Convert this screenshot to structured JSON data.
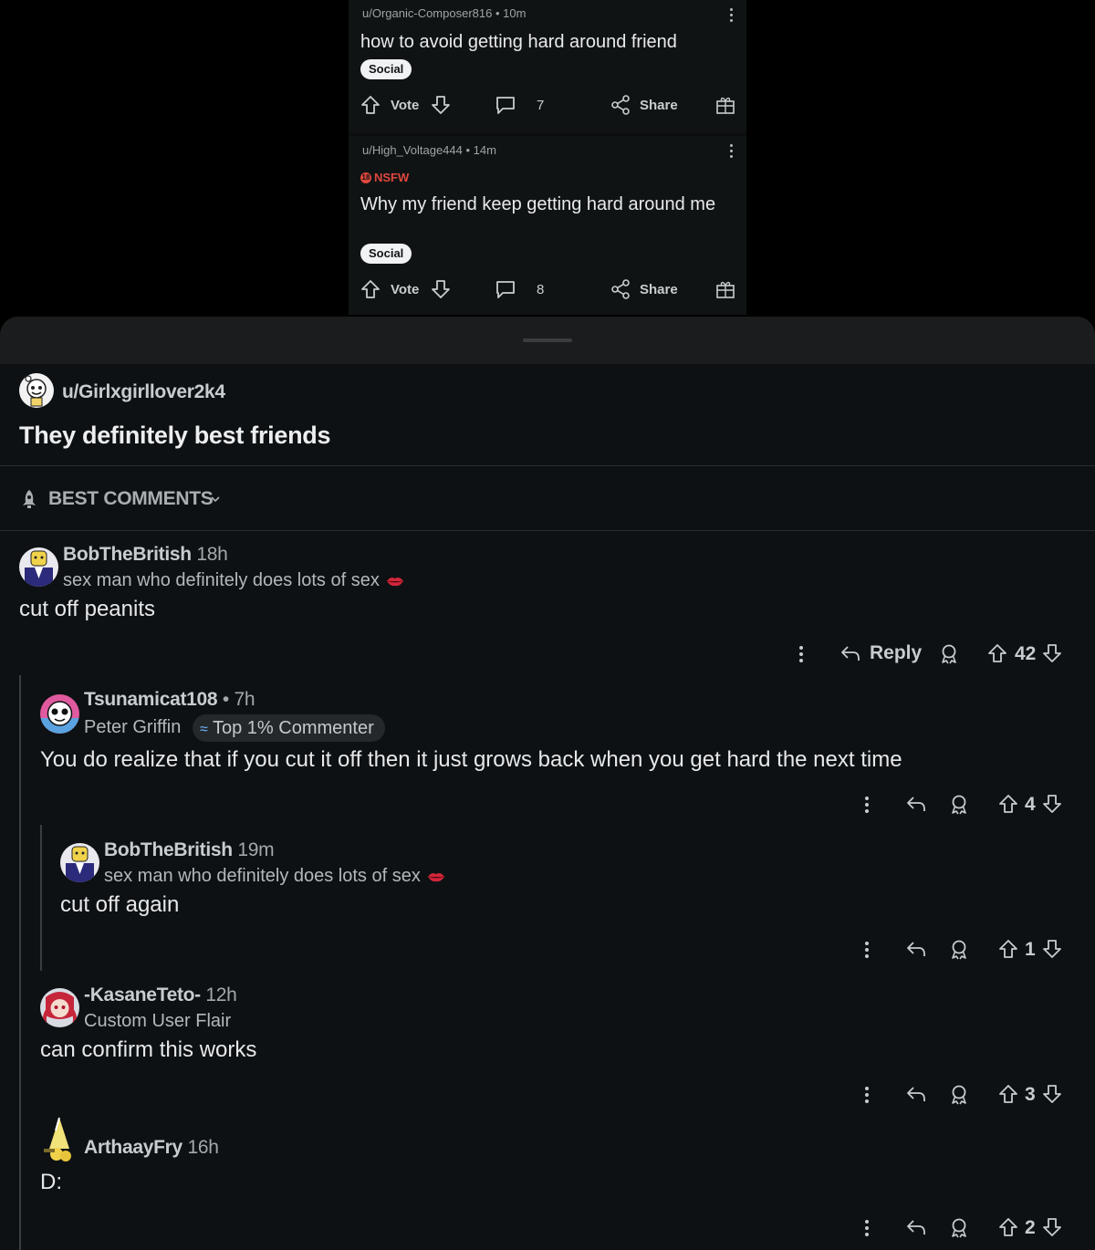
{
  "feed": {
    "posts": [
      {
        "author": "u/Organic-Composer816",
        "time": "10m",
        "nsfw": false,
        "title": "how to avoid getting hard around friend",
        "flair": "Social",
        "vote_label": "Vote",
        "comments": "7",
        "share_label": "Share"
      },
      {
        "author": "u/High_Voltage444",
        "time": "14m",
        "nsfw": true,
        "nsfw_label": "NSFW",
        "title": "Why my friend keep getting hard around me",
        "flair": "Social",
        "vote_label": "Vote",
        "comments": "8",
        "share_label": "Share"
      }
    ]
  },
  "post": {
    "author": "u/Girlxgirllover2k4",
    "title": "They definitely best friends"
  },
  "sort": {
    "label": "BEST COMMENTS"
  },
  "comments": [
    {
      "author": "BobTheBritish",
      "time": "18h",
      "flair": "sex man who definitely does lots of sex",
      "body": "cut off peanits",
      "reply_label": "Reply",
      "score": "42"
    },
    {
      "author": "Tsunamicat108",
      "sep": "•",
      "time": "7h",
      "flair": "Peter Griffin",
      "badge": "Top 1% Commenter",
      "body": "You do realize that if you cut it off then it just grows back when you get hard the next time",
      "score": "4"
    },
    {
      "author": "BobTheBritish",
      "time": "19m",
      "flair": "sex man who definitely does lots of sex",
      "body": "cut off again",
      "score": "1"
    },
    {
      "author": "-KasaneTeto-",
      "time": "12h",
      "flair": "Custom User Flair",
      "body": "can confirm this works",
      "score": "3"
    },
    {
      "author": "ArthaayFry",
      "time": "16h",
      "body": "D:",
      "score": "2"
    }
  ],
  "icons": {
    "upvote": "arrow-up-icon",
    "downvote": "arrow-down-icon",
    "comment": "speech-bubble-icon",
    "share": "share-icon",
    "award": "award-icon",
    "reply": "reply-arrow-icon",
    "more": "kebab-icon",
    "sort": "rocket-icon"
  },
  "colors": {
    "background": "#0e1113",
    "nsfw": "#e0473d",
    "text": "#e6e8ea"
  }
}
